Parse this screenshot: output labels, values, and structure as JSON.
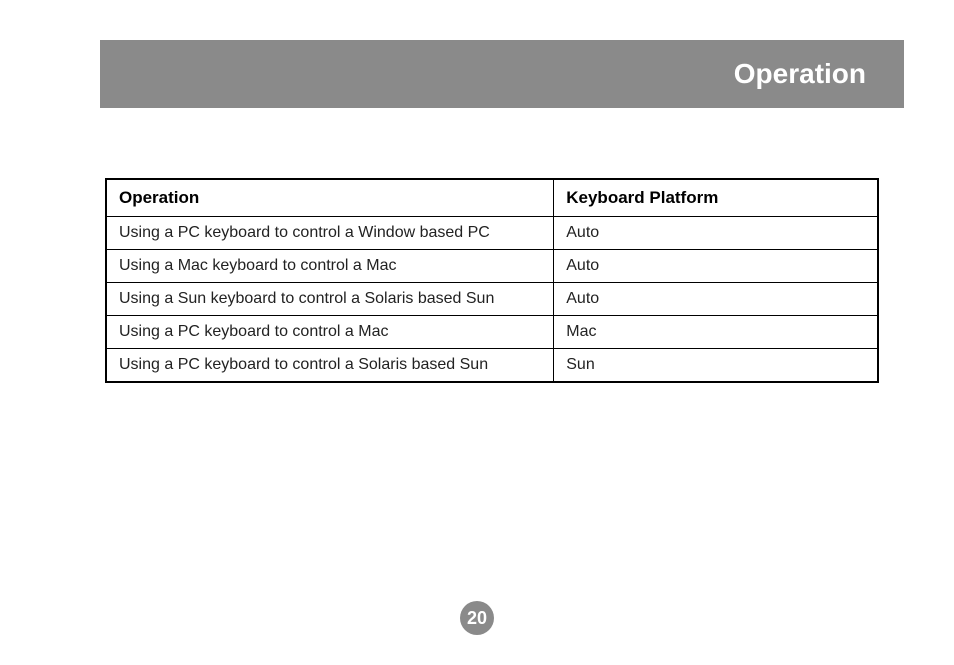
{
  "header": {
    "title": "Operation"
  },
  "table": {
    "headers": {
      "col1": "Operation",
      "col2": "Keyboard Platform"
    },
    "rows": [
      {
        "operation": "Using a PC keyboard to control a Window based PC",
        "platform": "Auto"
      },
      {
        "operation": "Using a Mac keyboard to control a Mac",
        "platform": "Auto"
      },
      {
        "operation": "Using a Sun keyboard to control a Solaris based Sun",
        "platform": "Auto"
      },
      {
        "operation": "Using a PC keyboard to control a Mac",
        "platform": "Mac"
      },
      {
        "operation": "Using a PC keyboard to control a Solaris based Sun",
        "platform": "Sun"
      }
    ]
  },
  "page_number": "20"
}
